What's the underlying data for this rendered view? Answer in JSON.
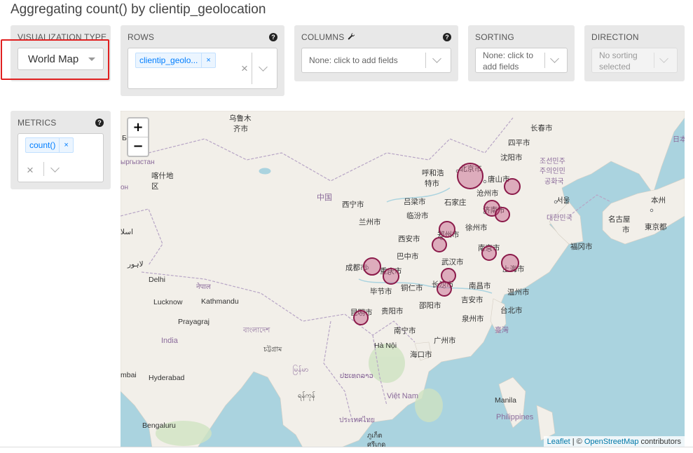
{
  "title": "Aggregating count() by clientip_geolocation",
  "visualization": {
    "label": "VISUALIZATION TYPE",
    "value": "World Map"
  },
  "rows": {
    "label": "ROWS",
    "tag": "clientip_geolo...",
    "tag_remove": "×",
    "clear": "×"
  },
  "columns": {
    "label": "COLUMNS",
    "placeholder": "None: click to add fields"
  },
  "sorting": {
    "label": "SORTING",
    "placeholder": "None: click to add fields"
  },
  "direction": {
    "label": "DIRECTION",
    "placeholder": "No sorting selected"
  },
  "metrics": {
    "label": "METRICS",
    "tag": "count()",
    "tag_remove": "×",
    "clear": "×"
  },
  "help_glyph": "?",
  "map": {
    "zoom_in": "+",
    "zoom_out": "−",
    "attribution_leaflet": "Leaflet",
    "attribution_sep": " | © ",
    "attribution_osm": "OpenStreetMap",
    "attribution_suffix": " contributors",
    "places": [
      "乌鲁木",
      "齐市",
      "长春市",
      "四平市",
      "沈阳市",
      "呼和浩",
      "特市",
      "北京市",
      "唐山市",
      "조선민주",
      "주의인민",
      "공화국",
      "서울",
      "대한민국",
      "日本",
      "本州",
      "名古屋",
      "市",
      "東京都",
      "福冈市",
      "石家庄",
      "吕梁市",
      "临汾市",
      "沧州市",
      "济南市",
      "西宁市",
      "兰州市",
      "中国",
      "西安市",
      "郑州市",
      "徐州市",
      "南京市",
      "巴中市",
      "成都市",
      "重庆市",
      "武汉市",
      "上海市",
      "毕节市",
      "铜仁市",
      "长沙市",
      "南昌市",
      "温州市",
      "昆明市",
      "贵阳市",
      "邵阳市",
      "吉安市",
      "台北市",
      "泉州市",
      "臺灣",
      "南宁市",
      "广州市",
      "Hà Nội",
      "海口市",
      "ыргызстан",
      "он",
      "喀什地",
      "区",
      "Delhi",
      "नेपाल",
      "Kathmandu",
      "Lucknow",
      "Prayagraj",
      "বাংলাদেশ",
      "চট্টগ্রাম",
      "India",
      "mbai",
      "Hyderabad",
      "Bengaluru",
      "မြန်မာ",
      "ရန်ကုန်",
      "ประเทศไทย",
      "ປະເທດລາວ",
      "Việt Nam",
      "Manila",
      "Philippines",
      "ภูเก็ต",
      "ศรีเกด",
      "لاہور",
      "اسلا",
      "Б"
    ]
  },
  "colors": {
    "panel_bg": "#e8e8e8",
    "tag_blue": "#007eff",
    "highlight_red": "#e02020",
    "marker_stroke": "#8b1a4a",
    "marker_fill": "#c45a85",
    "water": "#aad3df",
    "land": "#f2efe9"
  }
}
